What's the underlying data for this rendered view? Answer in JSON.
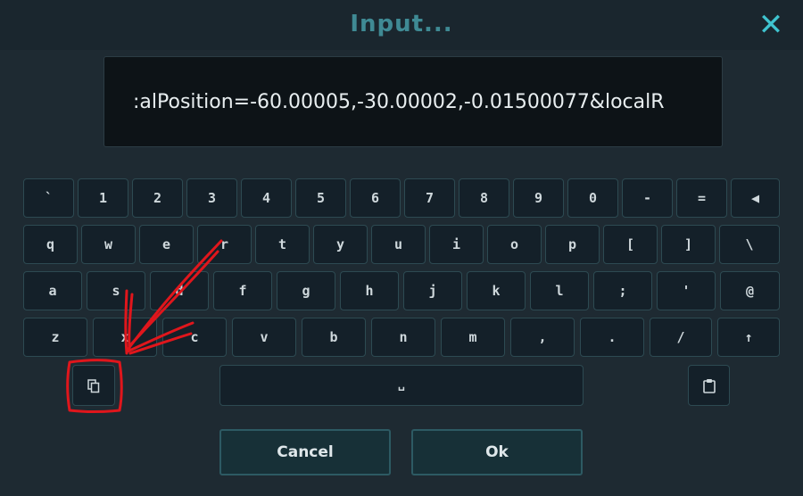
{
  "dialog": {
    "title": "Input...",
    "close_icon": "close-icon",
    "input_value": ":alPosition=-60.00005,-30.00002,-0.01500077&localR"
  },
  "keyboard": {
    "row1": [
      "`",
      "1",
      "2",
      "3",
      "4",
      "5",
      "6",
      "7",
      "8",
      "9",
      "0",
      "-",
      "=",
      "◀"
    ],
    "row2": [
      "q",
      "w",
      "e",
      "r",
      "t",
      "y",
      "u",
      "i",
      "o",
      "p",
      "[",
      "]",
      "\\"
    ],
    "row3": [
      "a",
      "s",
      "d",
      "f",
      "g",
      "h",
      "j",
      "k",
      "l",
      ";",
      "'",
      "@"
    ],
    "row4": [
      "z",
      "x",
      "c",
      "v",
      "b",
      "n",
      "m",
      ",",
      ".",
      "/",
      "↑"
    ],
    "space_label": "␣",
    "copy_icon": "copy-icon",
    "paste_icon": "paste-icon"
  },
  "buttons": {
    "cancel_label": "Cancel",
    "ok_label": "Ok"
  },
  "annotation": {
    "color": "#e0161c"
  }
}
